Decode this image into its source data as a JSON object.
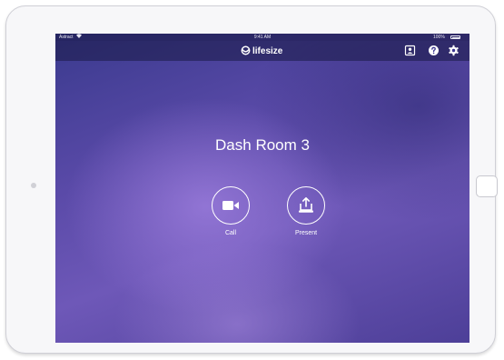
{
  "status_bar": {
    "carrier": "Astract",
    "wifi_icon": "wifi-icon",
    "time": "9:41 AM",
    "battery_percent": "100%",
    "battery_icon": "battery-icon"
  },
  "nav_bar": {
    "logo_text": "lifesize",
    "logo_icon": "lifesize-logo-icon",
    "icons": [
      "contacts-icon",
      "help-icon",
      "settings-icon"
    ]
  },
  "main": {
    "room_name": "Dash Room 3",
    "actions": [
      {
        "label": "Call",
        "icon": "video-camera-icon"
      },
      {
        "label": "Present",
        "icon": "share-screen-icon"
      }
    ]
  },
  "colors": {
    "background_top": "#3a3a8e",
    "background_mid": "#6e58b8",
    "accent_glow": "#a080e0",
    "text": "#ffffff"
  }
}
